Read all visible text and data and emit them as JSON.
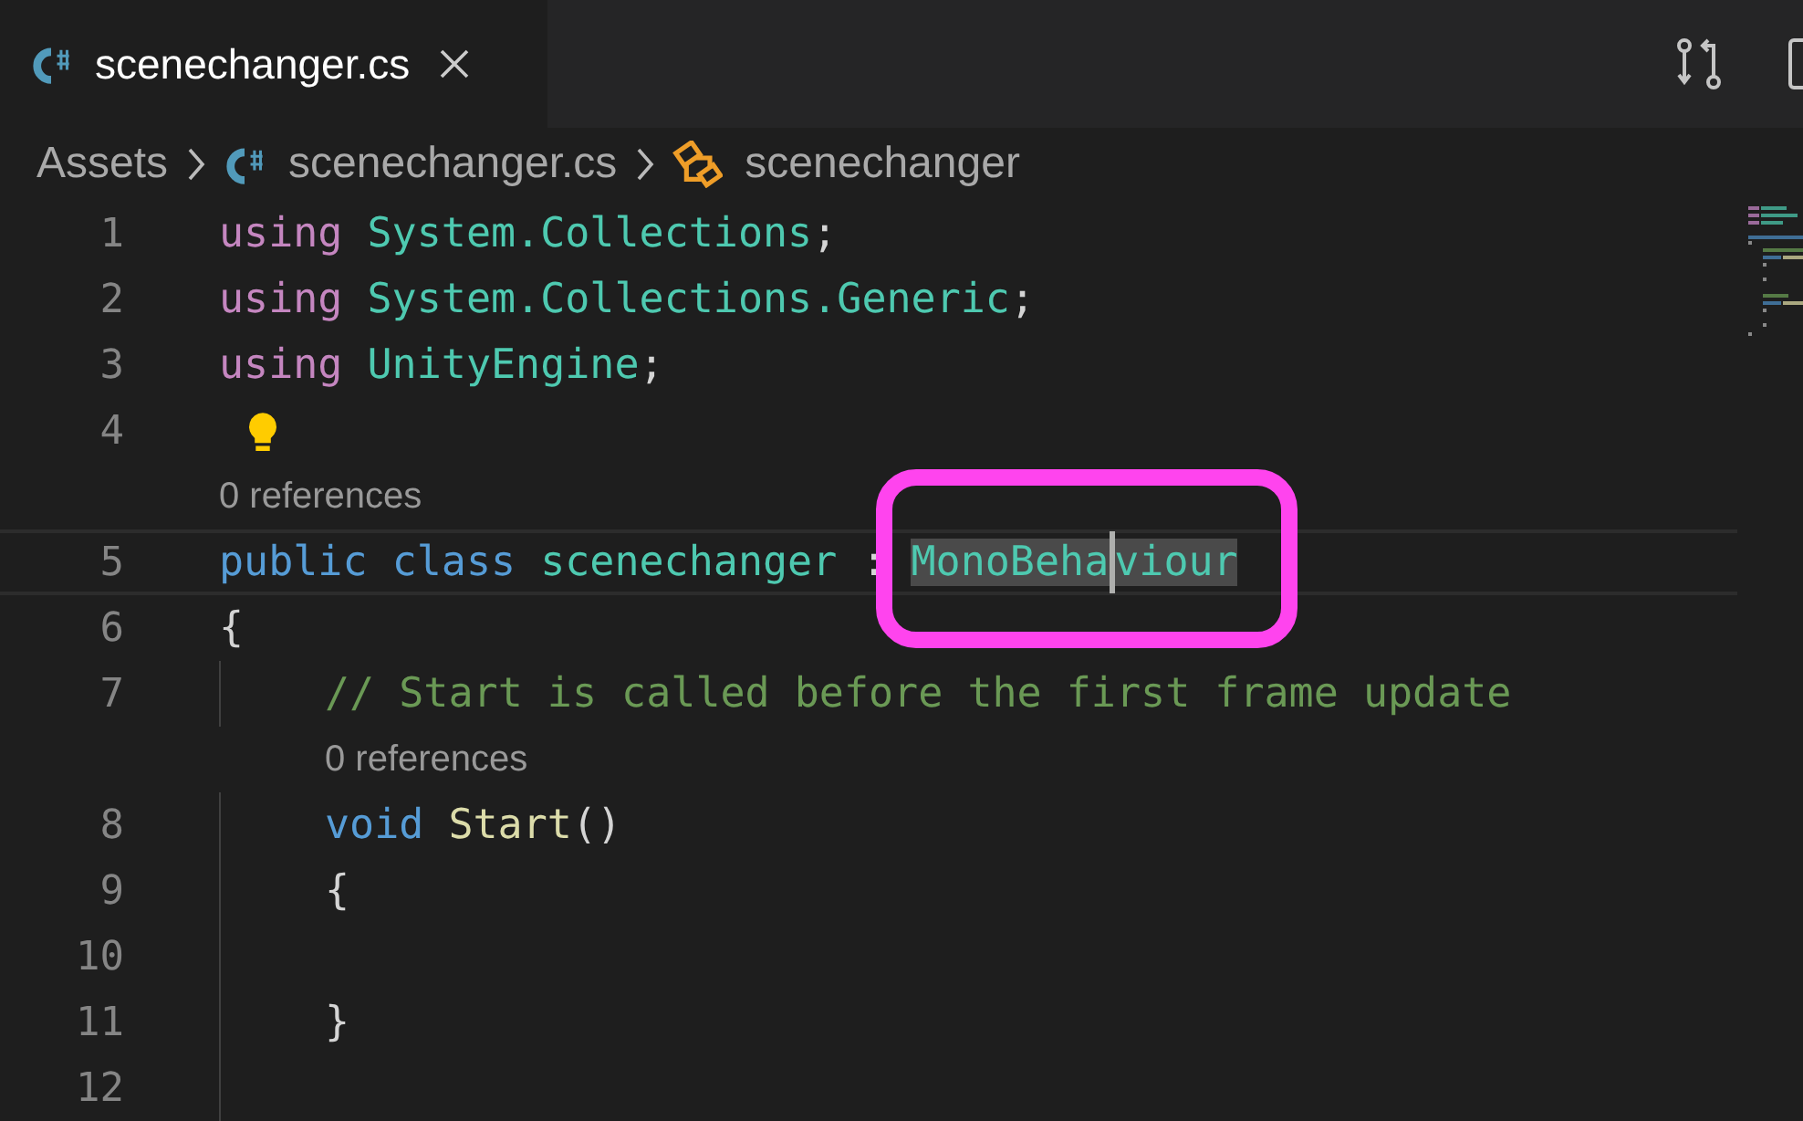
{
  "tabs": [
    {
      "label": "scenechanger.cs",
      "selected": true
    }
  ],
  "breadcrumbs": [
    {
      "label": "Assets",
      "kind": "folder"
    },
    {
      "label": "scenechanger.cs",
      "kind": "csharp"
    },
    {
      "label": "scenechanger",
      "kind": "class"
    }
  ],
  "rows": [
    {
      "kind": "code",
      "number": "1",
      "tokens": [
        {
          "text": "using",
          "kind": "directive"
        },
        {
          "kind": "gap"
        },
        {
          "text": "System.Collections",
          "kind": "type"
        },
        {
          "text": ";",
          "kind": "plain"
        }
      ]
    },
    {
      "kind": "code",
      "number": "2",
      "tokens": [
        {
          "text": "using",
          "kind": "directive"
        },
        {
          "kind": "gap"
        },
        {
          "text": "System.Collections.Generic",
          "kind": "type"
        },
        {
          "text": ";",
          "kind": "plain"
        }
      ]
    },
    {
      "kind": "code",
      "number": "3",
      "tokens": [
        {
          "text": "using",
          "kind": "directive"
        },
        {
          "kind": "gap"
        },
        {
          "text": "UnityEngine",
          "kind": "type"
        },
        {
          "text": ";",
          "kind": "plain"
        }
      ]
    },
    {
      "kind": "code",
      "number": "4",
      "tokens": [
        {
          "kind": "lightbulb"
        }
      ]
    },
    {
      "kind": "codelens",
      "text": "0 references",
      "tokens": []
    },
    {
      "kind": "code",
      "number": "5",
      "current": true,
      "tokens": [
        {
          "text": "public",
          "kind": "keyword"
        },
        {
          "kind": "gap"
        },
        {
          "text": "class",
          "kind": "keyword"
        },
        {
          "kind": "gap"
        },
        {
          "text": "scenechanger",
          "kind": "type"
        },
        {
          "kind": "gap"
        },
        {
          "text": ":",
          "kind": "plain"
        },
        {
          "kind": "gap"
        },
        {
          "kind": "annotation-start"
        },
        {
          "text": "MonoBeha",
          "kind": "type",
          "highlighted": true
        },
        {
          "kind": "cursor"
        },
        {
          "text": "viour",
          "kind": "type",
          "highlighted": true
        },
        {
          "kind": "annotation-end"
        }
      ]
    },
    {
      "kind": "code",
      "number": "6",
      "tokens": [
        {
          "text": "{",
          "kind": "plain"
        }
      ]
    },
    {
      "kind": "code",
      "number": "7",
      "tokens": [
        {
          "kind": "indent"
        },
        {
          "text": "// Start is called before the first frame update",
          "kind": "comment"
        }
      ]
    },
    {
      "kind": "codelens",
      "text": "0 references",
      "tokens": [
        {
          "kind": "indent-blank"
        }
      ]
    },
    {
      "kind": "code",
      "number": "8",
      "tokens": [
        {
          "kind": "indent"
        },
        {
          "text": "void",
          "kind": "keyword"
        },
        {
          "kind": "gap"
        },
        {
          "text": "Start",
          "kind": "method"
        },
        {
          "text": "()",
          "kind": "plain"
        }
      ]
    },
    {
      "kind": "code",
      "number": "9",
      "tokens": [
        {
          "kind": "indent"
        },
        {
          "text": "{",
          "kind": "plain"
        }
      ]
    },
    {
      "kind": "code",
      "number": "10",
      "tokens": [
        {
          "kind": "indent"
        }
      ]
    },
    {
      "kind": "code",
      "number": "11",
      "tokens": [
        {
          "kind": "indent"
        },
        {
          "text": "}",
          "kind": "plain"
        }
      ]
    },
    {
      "kind": "code",
      "number": "12",
      "tokens": [
        {
          "kind": "indent"
        }
      ]
    }
  ]
}
